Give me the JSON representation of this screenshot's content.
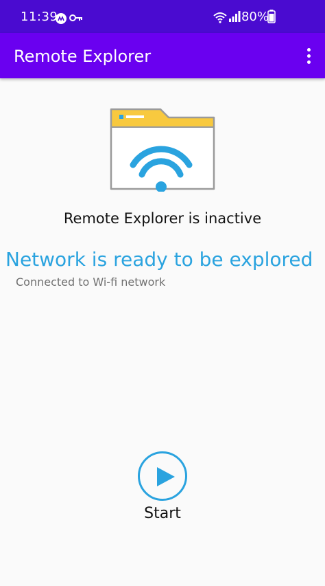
{
  "status_bar": {
    "time": "11:39",
    "battery": "80%"
  },
  "app_bar": {
    "title": "Remote Explorer"
  },
  "main": {
    "status_heading": "Remote Explorer is inactive",
    "network_title": "Network is ready to be explored",
    "network_subtitle": "Connected to Wi-fi network"
  },
  "actions": {
    "start_label": "Start"
  },
  "icons": {
    "status_left": [
      "whatsapp-icon",
      "key-icon"
    ],
    "status_right": [
      "wifi-icon",
      "signal-icon",
      "battery-icon"
    ],
    "menu": "more-vert-icon",
    "illustration": "folder-wifi-icon",
    "start": "play-icon"
  },
  "colors": {
    "status_bar": "#4a0bd0",
    "app_bar": "#6a00f0",
    "accent": "#2aa3df",
    "folder_tab": "#f8c93f"
  }
}
